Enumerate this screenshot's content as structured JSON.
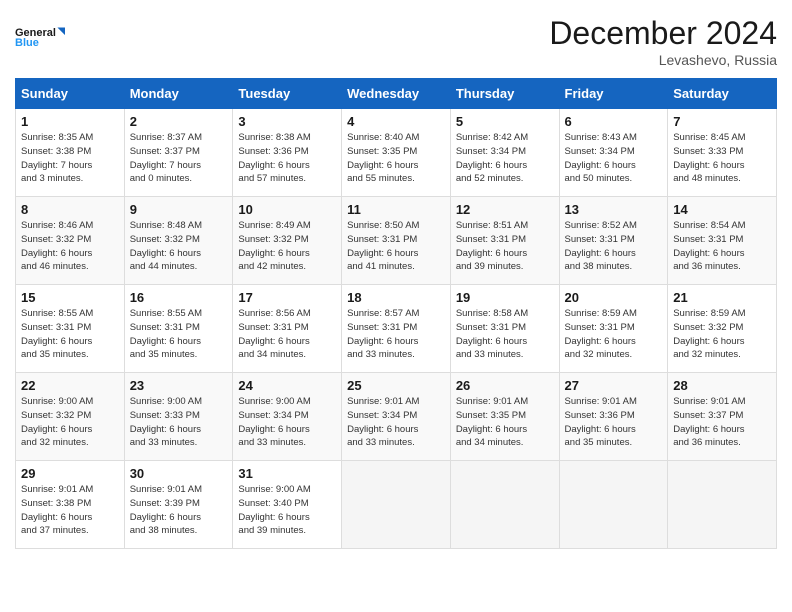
{
  "header": {
    "logo_line1": "General",
    "logo_line2": "Blue",
    "month": "December 2024",
    "location": "Levashevo, Russia"
  },
  "weekdays": [
    "Sunday",
    "Monday",
    "Tuesday",
    "Wednesday",
    "Thursday",
    "Friday",
    "Saturday"
  ],
  "weeks": [
    [
      {
        "day": "1",
        "info": "Sunrise: 8:35 AM\nSunset: 3:38 PM\nDaylight: 7 hours\nand 3 minutes."
      },
      {
        "day": "2",
        "info": "Sunrise: 8:37 AM\nSunset: 3:37 PM\nDaylight: 7 hours\nand 0 minutes."
      },
      {
        "day": "3",
        "info": "Sunrise: 8:38 AM\nSunset: 3:36 PM\nDaylight: 6 hours\nand 57 minutes."
      },
      {
        "day": "4",
        "info": "Sunrise: 8:40 AM\nSunset: 3:35 PM\nDaylight: 6 hours\nand 55 minutes."
      },
      {
        "day": "5",
        "info": "Sunrise: 8:42 AM\nSunset: 3:34 PM\nDaylight: 6 hours\nand 52 minutes."
      },
      {
        "day": "6",
        "info": "Sunrise: 8:43 AM\nSunset: 3:34 PM\nDaylight: 6 hours\nand 50 minutes."
      },
      {
        "day": "7",
        "info": "Sunrise: 8:45 AM\nSunset: 3:33 PM\nDaylight: 6 hours\nand 48 minutes."
      }
    ],
    [
      {
        "day": "8",
        "info": "Sunrise: 8:46 AM\nSunset: 3:32 PM\nDaylight: 6 hours\nand 46 minutes."
      },
      {
        "day": "9",
        "info": "Sunrise: 8:48 AM\nSunset: 3:32 PM\nDaylight: 6 hours\nand 44 minutes."
      },
      {
        "day": "10",
        "info": "Sunrise: 8:49 AM\nSunset: 3:32 PM\nDaylight: 6 hours\nand 42 minutes."
      },
      {
        "day": "11",
        "info": "Sunrise: 8:50 AM\nSunset: 3:31 PM\nDaylight: 6 hours\nand 41 minutes."
      },
      {
        "day": "12",
        "info": "Sunrise: 8:51 AM\nSunset: 3:31 PM\nDaylight: 6 hours\nand 39 minutes."
      },
      {
        "day": "13",
        "info": "Sunrise: 8:52 AM\nSunset: 3:31 PM\nDaylight: 6 hours\nand 38 minutes."
      },
      {
        "day": "14",
        "info": "Sunrise: 8:54 AM\nSunset: 3:31 PM\nDaylight: 6 hours\nand 36 minutes."
      }
    ],
    [
      {
        "day": "15",
        "info": "Sunrise: 8:55 AM\nSunset: 3:31 PM\nDaylight: 6 hours\nand 35 minutes."
      },
      {
        "day": "16",
        "info": "Sunrise: 8:55 AM\nSunset: 3:31 PM\nDaylight: 6 hours\nand 35 minutes."
      },
      {
        "day": "17",
        "info": "Sunrise: 8:56 AM\nSunset: 3:31 PM\nDaylight: 6 hours\nand 34 minutes."
      },
      {
        "day": "18",
        "info": "Sunrise: 8:57 AM\nSunset: 3:31 PM\nDaylight: 6 hours\nand 33 minutes."
      },
      {
        "day": "19",
        "info": "Sunrise: 8:58 AM\nSunset: 3:31 PM\nDaylight: 6 hours\nand 33 minutes."
      },
      {
        "day": "20",
        "info": "Sunrise: 8:59 AM\nSunset: 3:31 PM\nDaylight: 6 hours\nand 32 minutes."
      },
      {
        "day": "21",
        "info": "Sunrise: 8:59 AM\nSunset: 3:32 PM\nDaylight: 6 hours\nand 32 minutes."
      }
    ],
    [
      {
        "day": "22",
        "info": "Sunrise: 9:00 AM\nSunset: 3:32 PM\nDaylight: 6 hours\nand 32 minutes."
      },
      {
        "day": "23",
        "info": "Sunrise: 9:00 AM\nSunset: 3:33 PM\nDaylight: 6 hours\nand 33 minutes."
      },
      {
        "day": "24",
        "info": "Sunrise: 9:00 AM\nSunset: 3:34 PM\nDaylight: 6 hours\nand 33 minutes."
      },
      {
        "day": "25",
        "info": "Sunrise: 9:01 AM\nSunset: 3:34 PM\nDaylight: 6 hours\nand 33 minutes."
      },
      {
        "day": "26",
        "info": "Sunrise: 9:01 AM\nSunset: 3:35 PM\nDaylight: 6 hours\nand 34 minutes."
      },
      {
        "day": "27",
        "info": "Sunrise: 9:01 AM\nSunset: 3:36 PM\nDaylight: 6 hours\nand 35 minutes."
      },
      {
        "day": "28",
        "info": "Sunrise: 9:01 AM\nSunset: 3:37 PM\nDaylight: 6 hours\nand 36 minutes."
      }
    ],
    [
      {
        "day": "29",
        "info": "Sunrise: 9:01 AM\nSunset: 3:38 PM\nDaylight: 6 hours\nand 37 minutes."
      },
      {
        "day": "30",
        "info": "Sunrise: 9:01 AM\nSunset: 3:39 PM\nDaylight: 6 hours\nand 38 minutes."
      },
      {
        "day": "31",
        "info": "Sunrise: 9:00 AM\nSunset: 3:40 PM\nDaylight: 6 hours\nand 39 minutes."
      },
      {
        "day": "",
        "info": ""
      },
      {
        "day": "",
        "info": ""
      },
      {
        "day": "",
        "info": ""
      },
      {
        "day": "",
        "info": ""
      }
    ]
  ]
}
